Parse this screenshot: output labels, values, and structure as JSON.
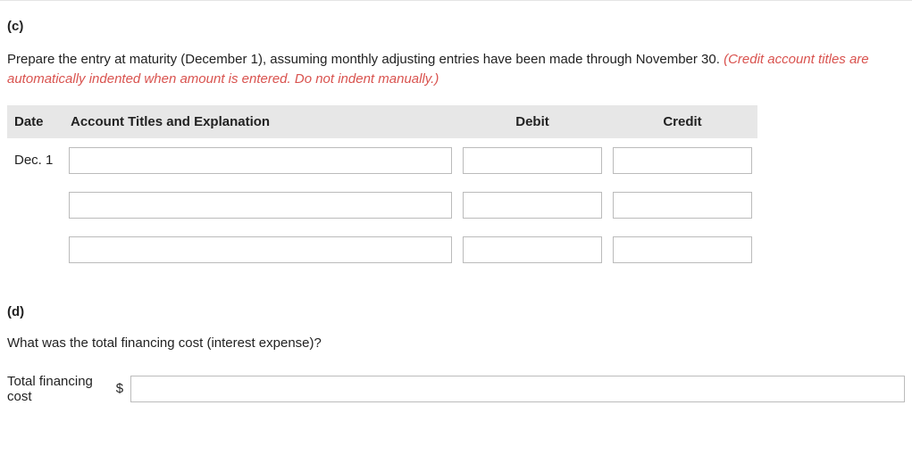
{
  "partC": {
    "label": "(c)",
    "instruction_black": "Prepare the entry at maturity (December 1), assuming monthly adjusting entries have been made through November 30. ",
    "instruction_red": "(Credit account titles are automatically indented when amount is entered. Do not indent manually.)",
    "headers": {
      "date": "Date",
      "account": "Account Titles and Explanation",
      "debit": "Debit",
      "credit": "Credit"
    },
    "date_value": "Dec. 1",
    "rows": [
      {
        "account": "",
        "debit": "",
        "credit": ""
      },
      {
        "account": "",
        "debit": "",
        "credit": ""
      },
      {
        "account": "",
        "debit": "",
        "credit": ""
      }
    ]
  },
  "partD": {
    "label": "(d)",
    "question": "What was the total financing cost (interest expense)?",
    "total_label": "Total financing cost",
    "currency": "$",
    "total_value": ""
  }
}
